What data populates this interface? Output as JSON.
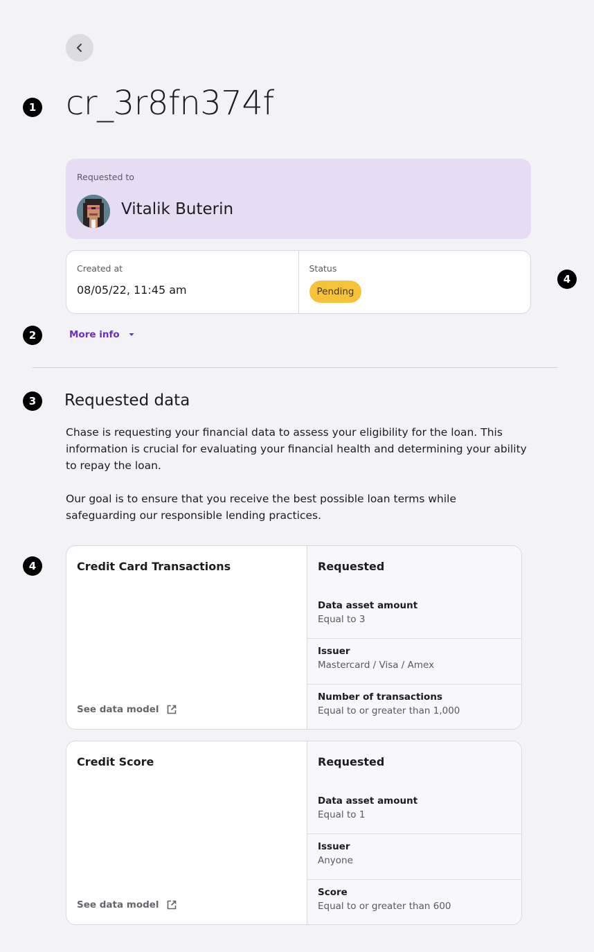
{
  "markers": [
    "1",
    "2",
    "3",
    "4",
    "4"
  ],
  "request_id": "cr_3r8fn374f",
  "requested_to": {
    "label": "Requested to",
    "name": "Vitalik Buterin"
  },
  "meta": {
    "created_label": "Created at",
    "created_value": "08/05/22, 11:45 am",
    "status_label": "Status",
    "status_value": "Pending",
    "status_color": "#f6c23a"
  },
  "more_info": {
    "label": "More info"
  },
  "section": {
    "title": "Requested data",
    "paragraph1": "Chase is requesting your financial data to assess your eligibility for the loan. This information is crucial for evaluating your financial health and determining your ability to repay the loan.",
    "paragraph2": "Our goal is to ensure that you receive the best possible loan terms while safeguarding our responsible lending practices."
  },
  "cards": [
    {
      "title": "Credit Card Transactions",
      "link": "See data model",
      "requested_label": "Requested",
      "rows": [
        {
          "key": "Data asset amount",
          "value": "Equal to 3"
        },
        {
          "key": "Issuer",
          "value": "Mastercard / Visa / Amex"
        },
        {
          "key": "Number of transactions",
          "value": "Equal to or greater than 1,000"
        }
      ]
    },
    {
      "title": "Credit Score",
      "link": "See data model",
      "requested_label": "Requested",
      "rows": [
        {
          "key": "Data asset amount",
          "value": "Equal to 1"
        },
        {
          "key": "Issuer",
          "value": "Anyone"
        },
        {
          "key": "Score",
          "value": "Equal to or greater than 600"
        }
      ]
    }
  ],
  "colors": {
    "accent": "#6b2fc0",
    "requested_to_bg": "#e6dcf3",
    "page_bg": "#f3f2f7"
  },
  "icons": [
    "chevron-left-icon",
    "caret-down-icon",
    "external-link-icon"
  ]
}
